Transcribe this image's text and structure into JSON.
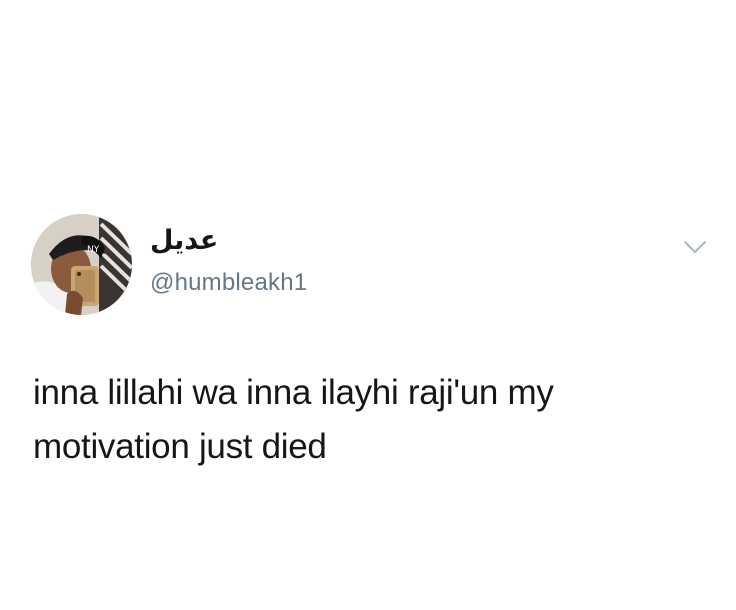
{
  "tweet": {
    "display_name": "عديل",
    "handle": "@humbleakh1",
    "text": "inna lillahi wa inna ilayhi raji'un my motivation just died"
  },
  "icons": {
    "avatar": "profile-photo-selfie",
    "menu": "chevron-down-icon"
  },
  "colors": {
    "text": "#14171a",
    "secondary_text": "#657786",
    "chevron": "#aab8c2",
    "background": "#ffffff"
  }
}
